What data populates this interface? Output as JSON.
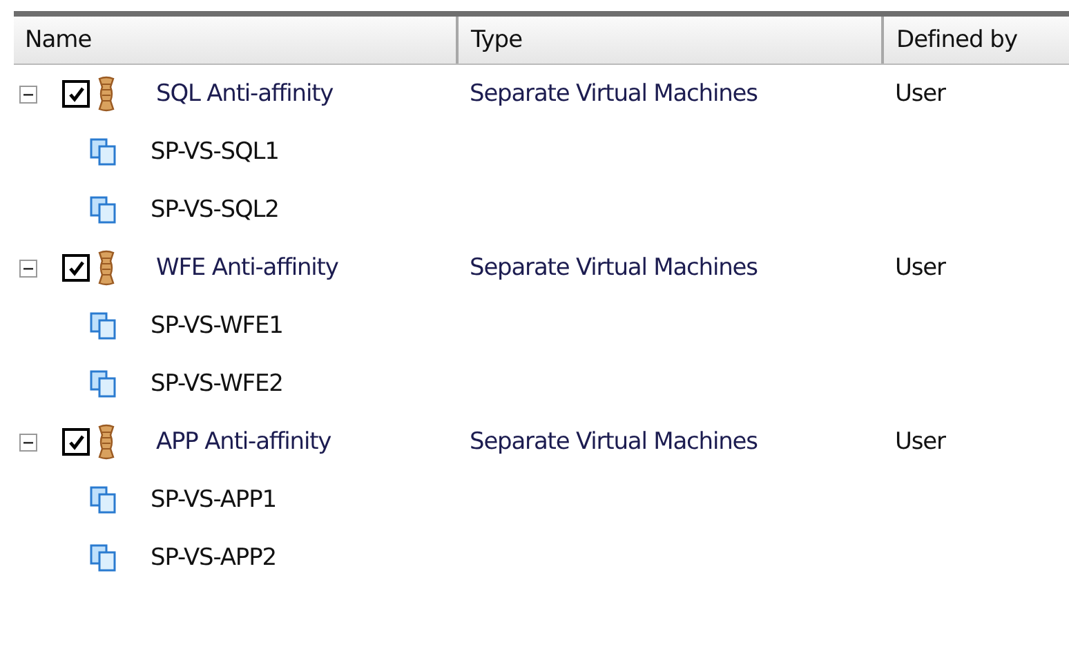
{
  "table": {
    "columns": [
      "Name",
      "Type",
      "Defined by"
    ],
    "rules": [
      {
        "name": "SQL Anti-affinity",
        "type": "Separate Virtual Machines",
        "defined_by": "User",
        "expanded": true,
        "checked": true,
        "children": [
          {
            "name": "SP-VS-SQL1"
          },
          {
            "name": "SP-VS-SQL2"
          }
        ]
      },
      {
        "name": "WFE Anti-affinity",
        "type": "Separate Virtual Machines",
        "defined_by": "User",
        "expanded": true,
        "checked": true,
        "children": [
          {
            "name": "SP-VS-WFE1"
          },
          {
            "name": "SP-VS-WFE2"
          }
        ]
      },
      {
        "name": "APP Anti-affinity",
        "type": "Separate Virtual Machines",
        "defined_by": "User",
        "expanded": true,
        "checked": true,
        "children": [
          {
            "name": "SP-VS-APP1"
          },
          {
            "name": "SP-VS-APP2"
          }
        ]
      }
    ]
  }
}
